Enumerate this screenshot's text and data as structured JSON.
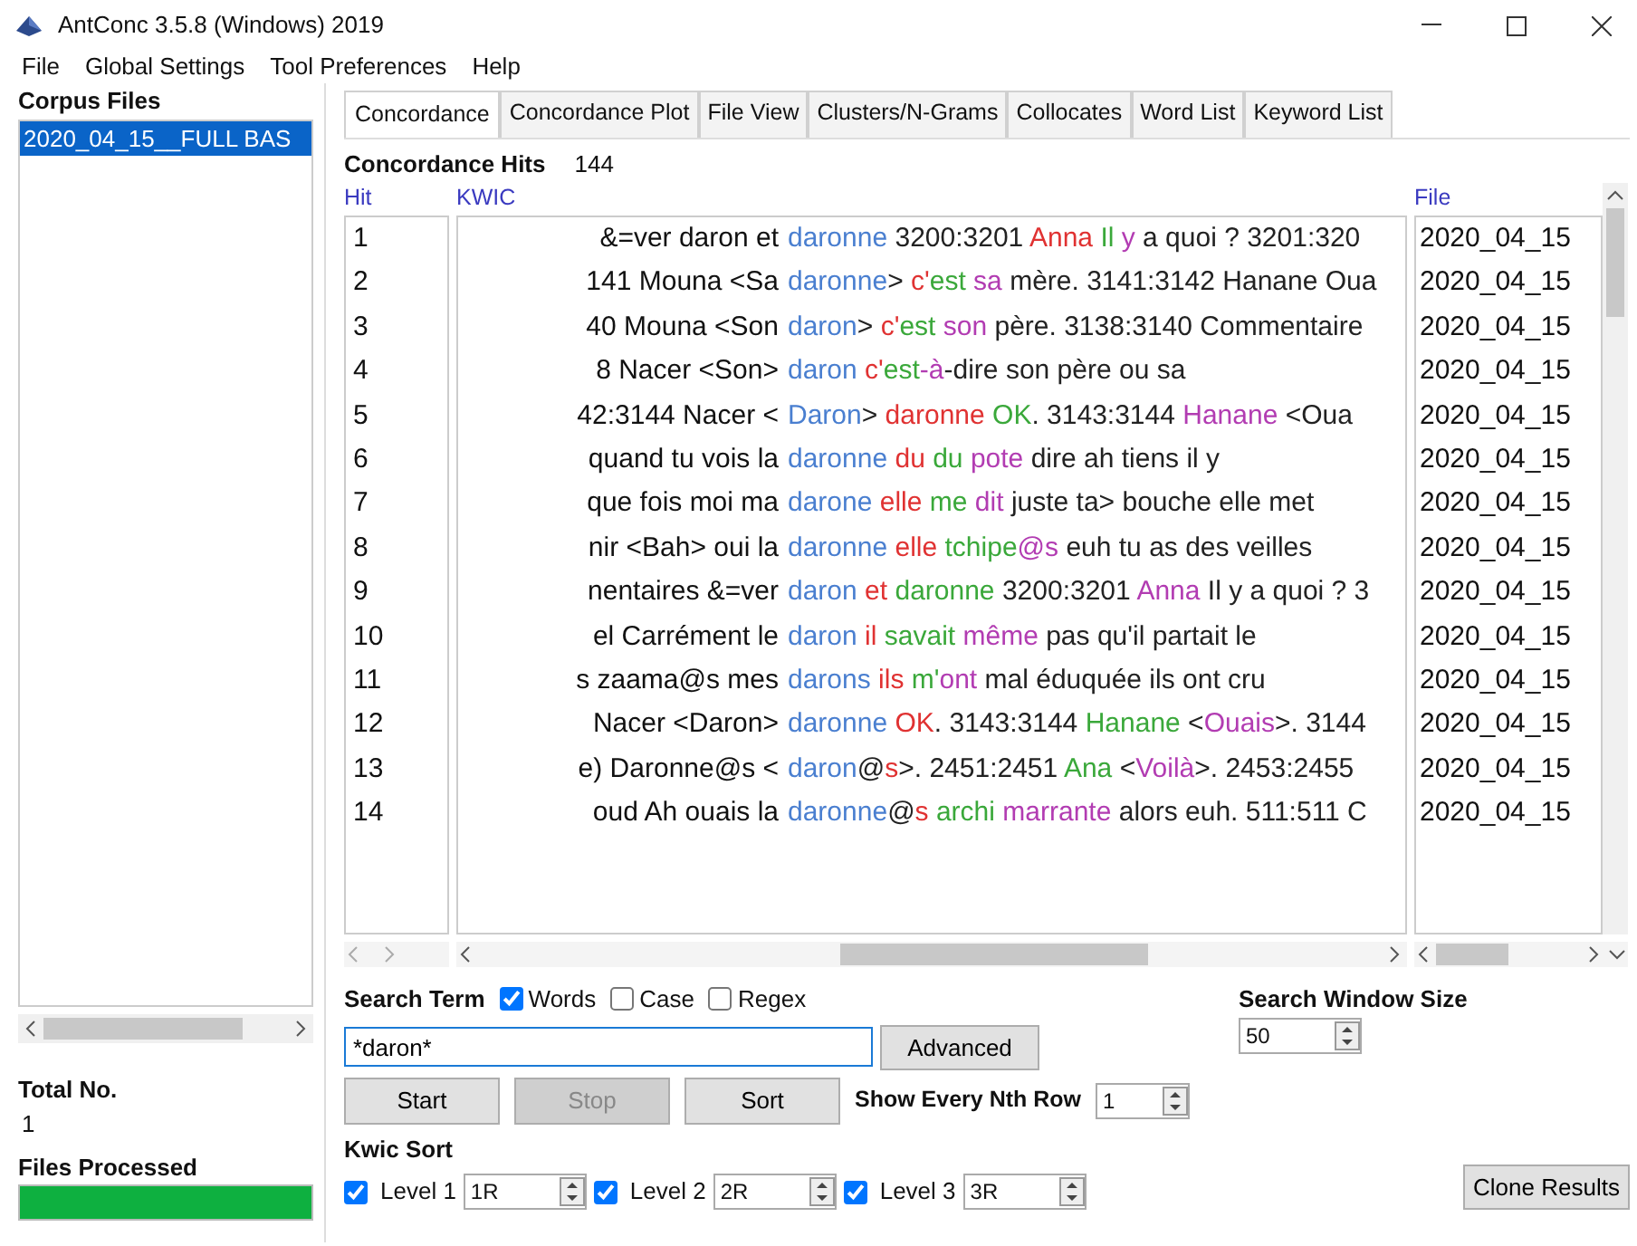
{
  "window": {
    "title": "AntConc 3.5.8 (Windows) 2019"
  },
  "menu": [
    "File",
    "Global Settings",
    "Tool Preferences",
    "Help"
  ],
  "corpus_files": {
    "title": "Corpus Files",
    "files": [
      {
        "name": "2020_04_15__FULL BAS",
        "selected": true
      }
    ]
  },
  "total_no": {
    "label": "Total No.",
    "value": "1"
  },
  "files_processed": {
    "label": "Files Processed",
    "level": 1
  },
  "tabs": [
    {
      "label": "Concordance",
      "selected": true
    },
    {
      "label": "Concordance Plot",
      "selected": false
    },
    {
      "label": "File View",
      "selected": false
    },
    {
      "label": "Clusters/N-Grams",
      "selected": false
    },
    {
      "label": "Collocates",
      "selected": false
    },
    {
      "label": "Word List",
      "selected": false
    },
    {
      "label": "Keyword List",
      "selected": false
    }
  ],
  "concordance": {
    "hits_label": "Concordance Hits",
    "hits_count": "144",
    "columns": [
      "Hit",
      "KWIC",
      "File"
    ],
    "rows": [
      {
        "hit": "1",
        "left": "&=ver daron et",
        "node": "daronne",
        "right": [
          {
            "text": " 3200:3201 ",
            "color": "#222222"
          },
          {
            "text": "Anna",
            "color": "#e03232"
          },
          {
            "text": " Il",
            "color": "#3aa83a"
          },
          {
            "text": " y",
            "color": "#b23cb2"
          },
          {
            "text": " a quoi ? 3201:320",
            "color": "#222222"
          }
        ],
        "file": "2020_04_15"
      },
      {
        "hit": "2",
        "left": "141 Mouna <Sa",
        "node": "daronne",
        "right": [
          {
            "text": "> ",
            "color": "#222222"
          },
          {
            "text": "c'",
            "color": "#e03232"
          },
          {
            "text": "est",
            "color": "#3aa83a"
          },
          {
            "text": " sa",
            "color": "#b23cb2"
          },
          {
            "text": " mère. 3141:3142 Hanane Oua",
            "color": "#222222"
          }
        ],
        "file": "2020_04_15"
      },
      {
        "hit": "3",
        "left": "40 Mouna <Son",
        "node": "daron",
        "right": [
          {
            "text": "> ",
            "color": "#222222"
          },
          {
            "text": "c'",
            "color": "#e03232"
          },
          {
            "text": "est",
            "color": "#3aa83a"
          },
          {
            "text": " son",
            "color": "#b23cb2"
          },
          {
            "text": " père. 3138:3140 Commentaire",
            "color": "#222222"
          }
        ],
        "file": "2020_04_15"
      },
      {
        "hit": "4",
        "left": "8 Nacer <Son>",
        "node": "daron",
        "right": [
          {
            "text": " c'",
            "color": "#e03232"
          },
          {
            "text": "est",
            "color": "#3aa83a"
          },
          {
            "text": "-à",
            "color": "#b23cb2"
          },
          {
            "text": "-dire son père ou sa",
            "color": "#222222"
          }
        ],
        "file": "2020_04_15"
      },
      {
        "hit": "5",
        "left": "42:3144 Nacer <",
        "node": "Daron",
        "right": [
          {
            "text": "> ",
            "color": "#222222"
          },
          {
            "text": "daronne",
            "color": "#e03232"
          },
          {
            "text": " OK",
            "color": "#3aa83a"
          },
          {
            "text": ". 3143:3144 ",
            "color": "#222222"
          },
          {
            "text": "Hanane",
            "color": "#b23cb2"
          },
          {
            "text": " <Oua",
            "color": "#222222"
          }
        ],
        "file": "2020_04_15"
      },
      {
        "hit": "6",
        "left": "quand tu vois la",
        "node": "daronne",
        "right": [
          {
            "text": " du",
            "color": "#e03232"
          },
          {
            "text": " du",
            "color": "#3aa83a"
          },
          {
            "text": " pote",
            "color": "#b23cb2"
          },
          {
            "text": " dire ah tiens il y",
            "color": "#222222"
          }
        ],
        "file": "2020_04_15"
      },
      {
        "hit": "7",
        "left": "que fois moi ma",
        "node": "darone",
        "right": [
          {
            "text": " elle",
            "color": "#e03232"
          },
          {
            "text": " me",
            "color": "#3aa83a"
          },
          {
            "text": " dit",
            "color": "#b23cb2"
          },
          {
            "text": " juste ta> bouche elle met",
            "color": "#222222"
          }
        ],
        "file": "2020_04_15"
      },
      {
        "hit": "8",
        "left": "nir <Bah> oui la",
        "node": "daronne",
        "right": [
          {
            "text": " elle",
            "color": "#e03232"
          },
          {
            "text": " tchipe",
            "color": "#3aa83a"
          },
          {
            "text": "@s",
            "color": "#b23cb2"
          },
          {
            "text": " euh tu as des veilles",
            "color": "#222222"
          }
        ],
        "file": "2020_04_15"
      },
      {
        "hit": "9",
        "left": "nentaires &=ver",
        "node": "daron",
        "right": [
          {
            "text": " et",
            "color": "#e03232"
          },
          {
            "text": " daronne",
            "color": "#3aa83a"
          },
          {
            "text": " 3200:3201 ",
            "color": "#222222"
          },
          {
            "text": "Anna",
            "color": "#b23cb2"
          },
          {
            "text": " Il y a quoi ? 3",
            "color": "#222222"
          }
        ],
        "file": "2020_04_15"
      },
      {
        "hit": "10",
        "left": "el Carrément le",
        "node": "daron",
        "right": [
          {
            "text": " il",
            "color": "#e03232"
          },
          {
            "text": " savait",
            "color": "#3aa83a"
          },
          {
            "text": " même",
            "color": "#b23cb2"
          },
          {
            "text": " pas qu'il partait le",
            "color": "#222222"
          }
        ],
        "file": "2020_04_15"
      },
      {
        "hit": "11",
        "left": "s zaama@s mes",
        "node": "darons",
        "right": [
          {
            "text": " ils",
            "color": "#e03232"
          },
          {
            "text": " m'",
            "color": "#3aa83a"
          },
          {
            "text": "ont",
            "color": "#b23cb2"
          },
          {
            "text": " mal éduquée ils ont cru",
            "color": "#222222"
          }
        ],
        "file": "2020_04_15"
      },
      {
        "hit": "12",
        "left": "Nacer <Daron>",
        "node": "daronne",
        "right": [
          {
            "text": " OK",
            "color": "#e03232"
          },
          {
            "text": ". 3143:3144 ",
            "color": "#222222"
          },
          {
            "text": "Hanane",
            "color": "#3aa83a"
          },
          {
            "text": " <",
            "color": "#222222"
          },
          {
            "text": "Ouais",
            "color": "#b23cb2"
          },
          {
            "text": ">. 3144",
            "color": "#222222"
          }
        ],
        "file": "2020_04_15"
      },
      {
        "hit": "13",
        "left": "e) Daronne@s <",
        "node": "daron",
        "right": [
          {
            "text": "@",
            "color": "#222222"
          },
          {
            "text": "s",
            "color": "#e03232"
          },
          {
            "text": ">. 2451:2451 ",
            "color": "#222222"
          },
          {
            "text": "Ana",
            "color": "#3aa83a"
          },
          {
            "text": " <",
            "color": "#222222"
          },
          {
            "text": "Voilà",
            "color": "#b23cb2"
          },
          {
            "text": ">. 2453:2455",
            "color": "#222222"
          }
        ],
        "file": "2020_04_15"
      },
      {
        "hit": "14",
        "left": "oud Ah ouais la",
        "node": "daronne",
        "right": [
          {
            "text": "@",
            "color": "#222222"
          },
          {
            "text": "s",
            "color": "#e03232"
          },
          {
            "text": " archi",
            "color": "#3aa83a"
          },
          {
            "text": " marrante",
            "color": "#b23cb2"
          },
          {
            "text": " alors euh. 511:511 C",
            "color": "#222222"
          }
        ],
        "file": "2020_04_15"
      }
    ]
  },
  "search": {
    "label": "Search Term",
    "options": [
      {
        "label": "Words",
        "checked": true
      },
      {
        "label": "Case",
        "checked": false
      },
      {
        "label": "Regex",
        "checked": false
      }
    ],
    "value": "*daron*",
    "advanced_button": "Advanced",
    "window_size_label": "Search Window Size",
    "window_size": "50",
    "buttons": [
      {
        "label": "Start",
        "disabled": false
      },
      {
        "label": "Stop",
        "disabled": true
      },
      {
        "label": "Sort",
        "disabled": false
      }
    ],
    "nth_row_label": "Show Every Nth Row",
    "nth_row": "1"
  },
  "kwic_sort": {
    "label": "Kwic Sort",
    "levels": [
      {
        "label": "Level 1",
        "checked": true,
        "value": "1R"
      },
      {
        "label": "Level 2",
        "checked": true,
        "value": "2R"
      },
      {
        "label": "Level 3",
        "checked": true,
        "value": "3R"
      }
    ]
  },
  "clone_button": "Clone Results"
}
